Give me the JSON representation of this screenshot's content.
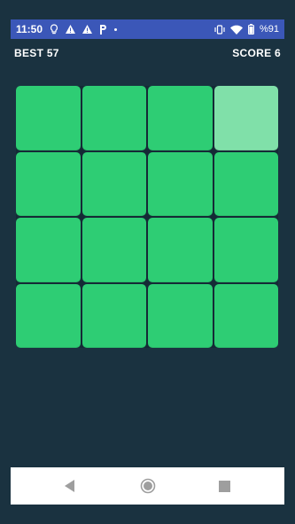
{
  "status": {
    "time": "11:50",
    "battery": "%91",
    "icons": [
      "lightbulb-icon",
      "warning-icon",
      "warning-icon",
      "parking-icon",
      "dot-icon",
      "vibrate-icon",
      "wifi-icon",
      "battery-icon"
    ]
  },
  "game": {
    "best_label": "BEST 57",
    "score_label": "SCORE 6",
    "grid": {
      "rows": 4,
      "cols": 4,
      "highlighted": [
        [
          0,
          3
        ]
      ]
    },
    "colors": {
      "background": "#1a3240",
      "tile": "#2ecd74",
      "tile_highlight": "#80e0a9"
    }
  },
  "nav": {
    "buttons": [
      "back-icon",
      "home-icon",
      "recents-icon"
    ]
  }
}
